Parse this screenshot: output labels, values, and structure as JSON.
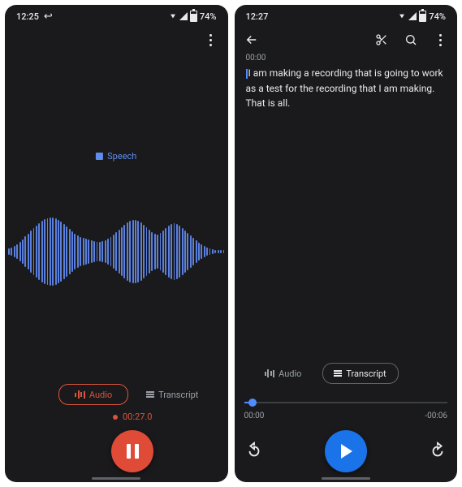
{
  "screen1": {
    "statusbar": {
      "time": "12:25",
      "battery": "74%"
    },
    "speech_label": "Speech",
    "tabs": {
      "audio": "Audio",
      "transcript": "Transcript"
    },
    "recording_time": "00:27.0"
  },
  "screen2": {
    "statusbar": {
      "time": "12:27",
      "battery": "74%"
    },
    "timestamp": "00:00",
    "transcript_text": "I am making a recording that is going to work as a test for the recording that I am making. That is all.",
    "tabs": {
      "audio": "Audio",
      "transcript": "Transcript"
    },
    "time_current": "00:00",
    "time_remaining": "-00:06"
  },
  "icons": {
    "back": "back-icon",
    "more": "more-icon",
    "cut": "cut-icon",
    "search": "search-icon",
    "pause": "pause-icon",
    "play": "play-icon",
    "rewind": "rewind-icon",
    "forward": "forward-icon"
  }
}
